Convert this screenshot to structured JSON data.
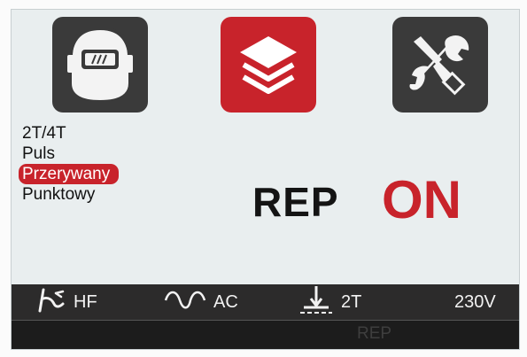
{
  "menu": {
    "items": [
      {
        "label": "2T/4T",
        "selected": false
      },
      {
        "label": "Puls",
        "selected": false
      },
      {
        "label": "Przerywany",
        "selected": true
      },
      {
        "label": "Punktowy",
        "selected": false
      }
    ]
  },
  "tiles": [
    {
      "icon": "welding-helmet-icon"
    },
    {
      "icon": "layers-icon",
      "active": true
    },
    {
      "icon": "wrench-screwdriver-icon"
    }
  ],
  "main": {
    "mode": "REP",
    "state": "ON"
  },
  "status": {
    "torch": "HF",
    "current": "AC",
    "trigger": "2T",
    "voltage": "230V"
  },
  "footer": {
    "text": "REP"
  },
  "colors": {
    "accent": "#c8232b",
    "tile_dark": "#3a3a3a",
    "screen_bg": "#e9eeef",
    "status_bg": "#2c2b2b"
  }
}
